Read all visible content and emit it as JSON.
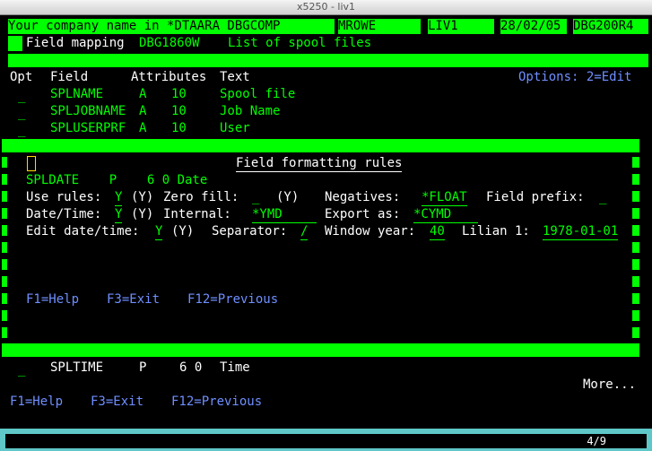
{
  "window": {
    "title": "x5250 - liv1"
  },
  "header": {
    "company": "Your company name in *DTAARA DBGCOMP",
    "user": "MROWE",
    "system": "LIV1",
    "date": "28/02/05",
    "program": "DBG200R4",
    "screen_label": "Field mapping",
    "screen_id": "DBG1860W",
    "screen_title": "List of spool files"
  },
  "list": {
    "headers": {
      "opt": "Opt",
      "field": "Field",
      "attributes": "Attributes",
      "text": "Text"
    },
    "options_hint": "Options: 2=Edit",
    "rows": [
      {
        "opt": "_",
        "field": "SPLNAME",
        "type": "A",
        "length": "10",
        "text": "Spool file"
      },
      {
        "opt": "_",
        "field": "SPLJOBNAME",
        "type": "A",
        "length": "10",
        "text": "Job Name"
      },
      {
        "opt": "_",
        "field": "SPLUSERPRF",
        "type": "A",
        "length": "10",
        "text": "User"
      }
    ]
  },
  "popup": {
    "title": "Field formatting rules",
    "field_line": "SPLDATE    P    6 0 Date",
    "use_rules_label": "Use rules:",
    "use_rules_value": "Y",
    "use_rules_hint": "(Y)",
    "zero_fill_label": "Zero fill:",
    "zero_fill_value": "_",
    "zero_fill_hint": "(Y)",
    "negatives_label": "Negatives:",
    "negatives_value": "*FLOAT",
    "field_prefix_label": "Field prefix:",
    "field_prefix_value": "_",
    "datetime_label": "Date/Time:",
    "datetime_value": "Y",
    "datetime_hint": "(Y)",
    "internal_label": "Internal:",
    "internal_value": "*YMD",
    "export_label": "Export as:",
    "export_value": "*CYMD",
    "edit_dt_label": "Edit date/time:",
    "edit_dt_value": "Y",
    "edit_dt_hint": "(Y)",
    "separator_label": "Separator:",
    "separator_value": "/",
    "window_year_label": "Window year:",
    "window_year_value": "40",
    "lilian_label": "Lilian 1:",
    "lilian_value": "1978-01-01",
    "fkeys": {
      "f1": "F1=Help",
      "f3": "F3=Exit",
      "f12": "F12=Previous"
    }
  },
  "after_row": {
    "opt": "_",
    "field": "SPLTIME",
    "type": "P",
    "length": "6 0",
    "text": "Time"
  },
  "more": "More...",
  "fkeys": {
    "f1": "F1=Help",
    "f3": "F3=Exit",
    "f12": "F12=Previous"
  },
  "status": {
    "position": "4/9"
  }
}
